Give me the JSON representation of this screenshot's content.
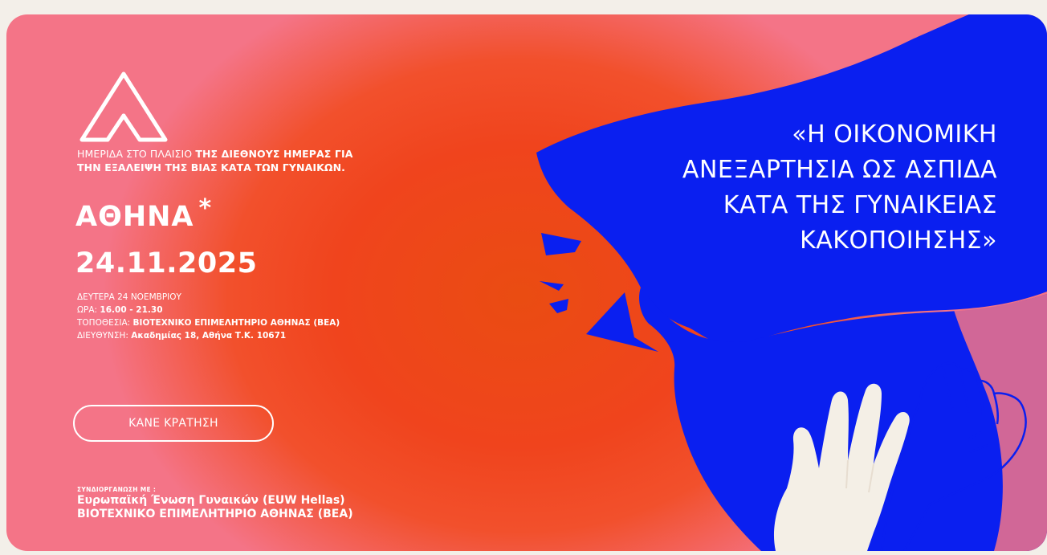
{
  "intro": {
    "line1_regular": "ΗΜΕΡΙΔΑ ΣΤΟ ΠΛΑΙΣΙΟ ",
    "line1_bold": "ΤΗΣ ΔΙΕΘΝΟΥΣ ΗΜΕΡΑΣ ΓΙΑ",
    "line2_bold": "ΤΗΝ ΕΞΑΛΕΙΨΗ ΤΗΣ ΒΙΑΣ ΚΑΤΑ ΤΩΝ ΓΥΝΑΙΚΩΝ."
  },
  "event": {
    "city": "ΑΘΗΝΑ",
    "asterisk": "*",
    "date": "24.11.2025",
    "day_label": "ΔΕΥΤΕΡΑ 24 ΝΟΕΜΒΡΙΟΥ",
    "time_label": "ΩΡΑ: ",
    "time_value": "16.00 - 21.30",
    "location_label": "ΤΟΠΟΘΕΣΙΑ: ",
    "location_value": "ΒΙΟΤΕΧΝΙΚΟ ΕΠΙΜΕΛΗΤΗΡΙΟ ΑΘΗΝΑΣ (ΒΕΑ)",
    "address_label": "ΔΙΕΥΘΥΝΣΗ: ",
    "address_value": "Ακαδημίας 18, Αθήνα Τ.Κ. 10671"
  },
  "booking": {
    "button_label": "ΚΑΝΕ ΚΡΑΤΗΣΗ"
  },
  "coorganizers": {
    "label": "ΣΥΝΔΙΟΡΓΑΝΩΣΗ ΜΕ :",
    "items": [
      "Ευρωπαϊκή Ένωση Γυναικών (EUW Hellas)",
      "ΒΙΟΤΕΧΝΙΚΟ ΕΠΙΜΕΛΗΤΗΡΙΟ ΑΘΗΝΑΣ (ΒΕΑ)"
    ]
  },
  "headline": {
    "lines": [
      "«Η ΟΙΚΟΝΟΜΙΚΗ",
      "ΑΝΕΞΑΡΤΗΣΙΑ ΩΣ ΑΣΠΙΔΑ",
      "ΚΑΤΑ ΤΗΣ ΓΥΝΑΙΚΕΙΑΣ",
      "ΚΑΚΟΠΟΙΗΣΗΣ»"
    ]
  },
  "icons": {
    "logo": "triangle-logo-icon",
    "illustration": "woman-profile-illustration",
    "hand": "raised-hand-icon",
    "fist": "raised-fist-icon"
  },
  "colors": {
    "orange": "#f0441d",
    "pink": "#f47487",
    "blue": "#0a1ff0",
    "cream": "#f4efe6",
    "white": "#ffffff"
  }
}
